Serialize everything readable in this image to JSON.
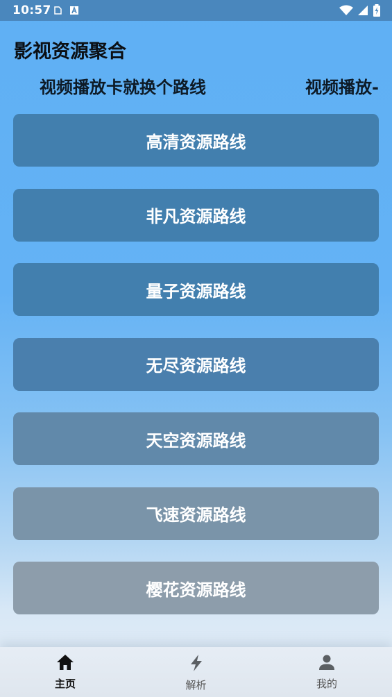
{
  "status_bar": {
    "time": "10:57",
    "icons": [
      "clipboard-icon",
      "font-a-icon",
      "wifi-icon",
      "signal-icon",
      "battery-charging-icon"
    ]
  },
  "app": {
    "title": "影视资源聚合",
    "marquee": [
      "视频播放卡就换个路线",
      "视频播放-"
    ]
  },
  "routes": [
    {
      "label": "高清资源路线",
      "color": "#427fae"
    },
    {
      "label": "非凡资源路线",
      "color": "#427fae"
    },
    {
      "label": "量子资源路线",
      "color": "#427fae"
    },
    {
      "label": "无尽资源路线",
      "color": "#4a7fad"
    },
    {
      "label": "天空资源路线",
      "color": "#6189aa"
    },
    {
      "label": "飞速资源路线",
      "color": "#7a94a9"
    },
    {
      "label": "樱花资源路线",
      "color": "#8d9dab"
    }
  ],
  "bottom_nav": {
    "items": [
      {
        "label": "主页",
        "icon": "home-icon",
        "active": true
      },
      {
        "label": "解析",
        "icon": "bolt-icon",
        "active": false
      },
      {
        "label": "我的",
        "icon": "person-icon",
        "active": false
      }
    ]
  }
}
